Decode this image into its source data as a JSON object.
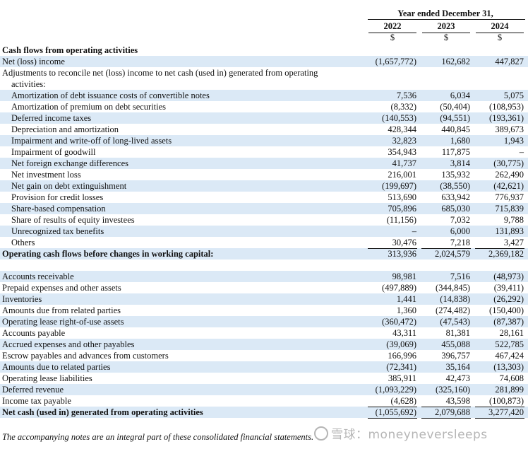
{
  "header": {
    "period": "Year ended December 31,",
    "years": [
      "2022",
      "2023",
      "2024"
    ],
    "currency": "$"
  },
  "rows": [
    {
      "label": "Cash flows from operating activities",
      "type": "section"
    },
    {
      "label": "Net (loss) income",
      "values": [
        "(1,657,772)",
        "162,682",
        "447,827"
      ],
      "shade": true
    },
    {
      "label": "Adjustments to reconcile net (loss) income to net cash (used in) generated from operating",
      "type": "text"
    },
    {
      "label": "activities:",
      "type": "text-ind"
    },
    {
      "label": "Amortization of debt issuance costs of convertible notes",
      "values": [
        "7,536",
        "6,034",
        "5,075"
      ],
      "shade": true,
      "indent": true
    },
    {
      "label": "Amortization of premium on debt securities",
      "values": [
        "(8,332)",
        "(50,404)",
        "(108,953)"
      ],
      "indent": true
    },
    {
      "label": "Deferred income taxes",
      "values": [
        "(140,553)",
        "(94,551)",
        "(193,361)"
      ],
      "shade": true,
      "indent": true
    },
    {
      "label": "Depreciation and amortization",
      "values": [
        "428,344",
        "440,845",
        "389,673"
      ],
      "indent": true
    },
    {
      "label": "Impairment and write-off of long-lived assets",
      "values": [
        "32,823",
        "1,680",
        "1,943"
      ],
      "shade": true,
      "indent": true
    },
    {
      "label": "Impairment of goodwill",
      "values": [
        "354,943",
        "117,875",
        "–"
      ],
      "indent": true
    },
    {
      "label": "Net foreign exchange differences",
      "values": [
        "41,737",
        "3,814",
        "(30,775)"
      ],
      "shade": true,
      "indent": true
    },
    {
      "label": "Net investment loss",
      "values": [
        "216,001",
        "135,932",
        "262,490"
      ],
      "indent": true
    },
    {
      "label": "Net gain on debt extinguishment",
      "values": [
        "(199,697)",
        "(38,550)",
        "(42,621)"
      ],
      "shade": true,
      "indent": true
    },
    {
      "label": "Provision for credit losses",
      "values": [
        "513,690",
        "633,942",
        "776,937"
      ],
      "indent": true
    },
    {
      "label": "Share-based compensation",
      "values": [
        "705,896",
        "685,030",
        "715,839"
      ],
      "shade": true,
      "indent": true
    },
    {
      "label": "Share of results of equity investees",
      "values": [
        "(11,156)",
        "7,032",
        "9,788"
      ],
      "indent": true
    },
    {
      "label": "Unrecognized tax benefits",
      "values": [
        "–",
        "6,000",
        "131,893"
      ],
      "shade": true,
      "indent": true
    },
    {
      "label": "Others",
      "values": [
        "30,476",
        "7,218",
        "3,427"
      ],
      "indent": true
    },
    {
      "label": "Operating cash flows before changes in working capital:",
      "values": [
        "313,936",
        "2,024,579",
        "2,369,182"
      ],
      "shade": true,
      "bold": true,
      "topline": true
    },
    {
      "type": "spacer"
    },
    {
      "label": "Accounts receivable",
      "values": [
        "98,981",
        "7,516",
        "(48,973)"
      ],
      "shade": true
    },
    {
      "label": "Prepaid expenses and other assets",
      "values": [
        "(497,889)",
        "(344,845)",
        "(39,411)"
      ]
    },
    {
      "label": "Inventories",
      "values": [
        "1,441",
        "(14,838)",
        "(26,292)"
      ],
      "shade": true
    },
    {
      "label": "Amounts due from related parties",
      "values": [
        "1,360",
        "(274,482)",
        "(150,400)"
      ]
    },
    {
      "label": "Operating lease right-of-use assets",
      "values": [
        "(360,472)",
        "(47,543)",
        "(87,387)"
      ],
      "shade": true
    },
    {
      "label": "Accounts payable",
      "values": [
        "43,311",
        "81,381",
        "28,161"
      ]
    },
    {
      "label": "Accrued expenses and other payables",
      "values": [
        "(39,069)",
        "455,088",
        "522,785"
      ],
      "shade": true
    },
    {
      "label": "Escrow payables and advances from customers",
      "values": [
        "166,996",
        "396,757",
        "467,424"
      ]
    },
    {
      "label": "Amounts due to related parties",
      "values": [
        "(72,341)",
        "35,164",
        "(13,303)"
      ],
      "shade": true
    },
    {
      "label": "Operating lease liabilities",
      "values": [
        "385,911",
        "42,473",
        "74,608"
      ]
    },
    {
      "label": "Deferred revenue",
      "values": [
        "(1,093,229)",
        "(325,160)",
        "281,899"
      ],
      "shade": true
    },
    {
      "label": "Income tax payable",
      "values": [
        "(4,628)",
        "43,598",
        "(100,873)"
      ]
    },
    {
      "label": "Net cash (used in) generated from operating activities",
      "values": [
        "(1,055,692)",
        "2,079,688",
        "3,277,420"
      ],
      "shade": true,
      "bold": true,
      "topline": true,
      "boxed": true
    }
  ],
  "footer": {
    "note": "The accompanying notes are an integral part of these consolidated financial statements."
  },
  "watermark": {
    "text": "雪球：moneyneversleeps"
  }
}
